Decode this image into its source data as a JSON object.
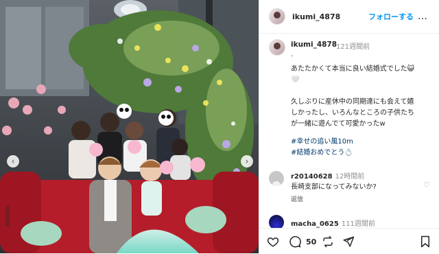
{
  "post": {
    "username": "ikumi_4878",
    "follow_label": "フォローする",
    "more_label": "…"
  },
  "caption": {
    "username": "ikumi_4878",
    "time": "121週間前",
    "dot": ".",
    "text": "あたたかくて本当に良い結婚式でした😺\n🤍\n\n久しぶりに産休中の同期達にも会えて嬉\nしかったし、いろんなところの子供たち\nが一緒に遊んでて可愛かったw",
    "hashtags": [
      "#幸せの追い風10m",
      "#結婚おめでとう💍"
    ]
  },
  "comments": [
    {
      "username": "r20140628",
      "time": "12時間前",
      "text": "長崎支部になってみないか?",
      "reply": "返信"
    },
    {
      "username": "macha_0625",
      "time": "111週間前",
      "text": ""
    }
  ],
  "actions": {
    "comment_count": "50"
  },
  "colors": {
    "link": "#0095f6",
    "hashtag": "#00376b",
    "muted": "#8e8e8e",
    "text": "#262626"
  },
  "icons": [
    "chevron-left-icon",
    "chevron-right-icon",
    "heart-icon",
    "comment-icon",
    "repost-icon",
    "share-icon",
    "bookmark-icon",
    "more-icon"
  ]
}
